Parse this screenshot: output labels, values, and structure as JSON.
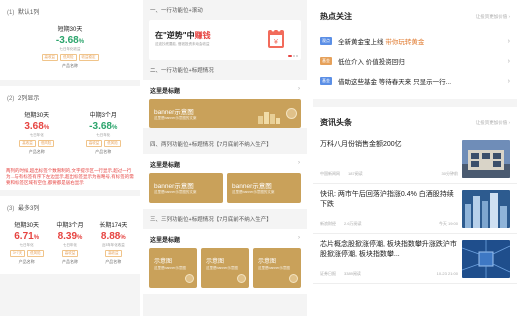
{
  "panel1": {
    "sec1": {
      "num": "(1)",
      "title": "默认1列"
    },
    "p_single": {
      "name": "短期30天",
      "rate": "-3.68",
      "unit": "%",
      "desc": "七日年化收益",
      "tags": [
        "高收益",
        "低风险",
        "收益稳定"
      ],
      "foot": "产品名称"
    },
    "sec2": {
      "num": "(2)",
      "title": "2列显示"
    },
    "p_two": [
      {
        "name": "短期30天",
        "rate": "3.68",
        "unit": "%",
        "desc": "七日年化",
        "tags": [
          "高收益",
          "低风险"
        ],
        "foot": "产品名称"
      },
      {
        "name": "中期3个月",
        "rate": "-3.68",
        "unit": "%",
        "desc": "七日年化",
        "tags": [
          "高收益",
          "低风险"
        ],
        "foot": "产品名称"
      }
    ],
    "note": "两列的时候,超出标签个数限制的,文字提示区一行显示,超过一行为...与有标签有序下左边显示,超出标签显示为省略号,有标签的需要和标签区域有空位,都要都是居右显示",
    "sec3": {
      "num": "(3)",
      "title": "最多3列"
    },
    "p_three": [
      {
        "name": "短期30天",
        "rate": "6.71",
        "unit": "%",
        "desc": "七日年化",
        "tags": [
          "3+7天",
          "低风险"
        ],
        "foot": "产品名称"
      },
      {
        "name": "中期3个月",
        "rate": "8.39",
        "unit": "%",
        "desc": "七日年化",
        "tags": [
          "高收益"
        ],
        "foot": "产品名称"
      },
      {
        "name": "长期174天",
        "rate": "8.88",
        "unit": "%",
        "desc": "近3年年化收益",
        "tags": [
          "高收益"
        ],
        "foot": "产品名称"
      }
    ]
  },
  "panel2": {
    "s1_title": "一、一行功能位+滚动",
    "banner1": {
      "title_prefix": "在\"逆势\"中",
      "title_highlight": "赚钱",
      "sub": "这波抄底要趁, 借钱投资未动会收益"
    },
    "s2_title": "二、一行功能位+标题情况",
    "s2_block": {
      "title": "这里是标题",
      "banner_title": "banner示意图",
      "banner_sub": "这里是banner示意图的文案"
    },
    "s3_title": "四、两列功能位+标题情况【7月底前不纳入生产】",
    "s3_block": {
      "title": "这里是标题",
      "banners": [
        {
          "title": "banner示意图",
          "sub": "这里是banner示意图的文案"
        },
        {
          "title": "banner示意图",
          "sub": "这里是banner示意图的文案"
        }
      ]
    },
    "s4_title": "三、三列功能位+标题情况【7月底前不纳入生产】",
    "s4_block": {
      "title": "这里是标题",
      "banners": [
        {
          "title": "示意图",
          "sub": "这里是banner示意图"
        },
        {
          "title": "示意图",
          "sub": "这里是banner示意图"
        },
        {
          "title": "示意图",
          "sub": "这里是banner示意图"
        }
      ]
    }
  },
  "panel3": {
    "hot": {
      "title": "热点关注",
      "more": "让投资更加价值"
    },
    "hot_items": [
      {
        "badge": "观点",
        "text_pre": "全新黄金宝上线 ",
        "text_hl": "带你玩转黄金",
        "color": "#5b8fe6"
      },
      {
        "badge": "基金",
        "text_pre": "低位介入 价值投资回归",
        "text_hl": "",
        "color": "#e6a15a"
      },
      {
        "badge": "基金",
        "text_pre": "借助这些基金 等待春天来 只显示一行...",
        "text_hl": "",
        "color": "#5b8fe6"
      }
    ],
    "news": {
      "title": "资讯头条",
      "more": "让投资更加价值"
    },
    "news_items": [
      {
        "title": "万科八月份销售金额200亿",
        "source": "中国新闻网",
        "reads": "187阅读",
        "time": "30分钟前"
      },
      {
        "title": "快讯: 两市午后回落沪指涨0.4% 白酒股持续下跌",
        "source": "新浪财经",
        "reads": "2.6万阅读",
        "time": "今天 19:00"
      },
      {
        "title": "芯片概念股掀涨停潮, 板块指数攀升涨跌沪市股掀涨停潮, 板块指数攀...",
        "source": "证券日报",
        "reads": "3389阅读",
        "time": "10-23 21:00"
      }
    ]
  }
}
